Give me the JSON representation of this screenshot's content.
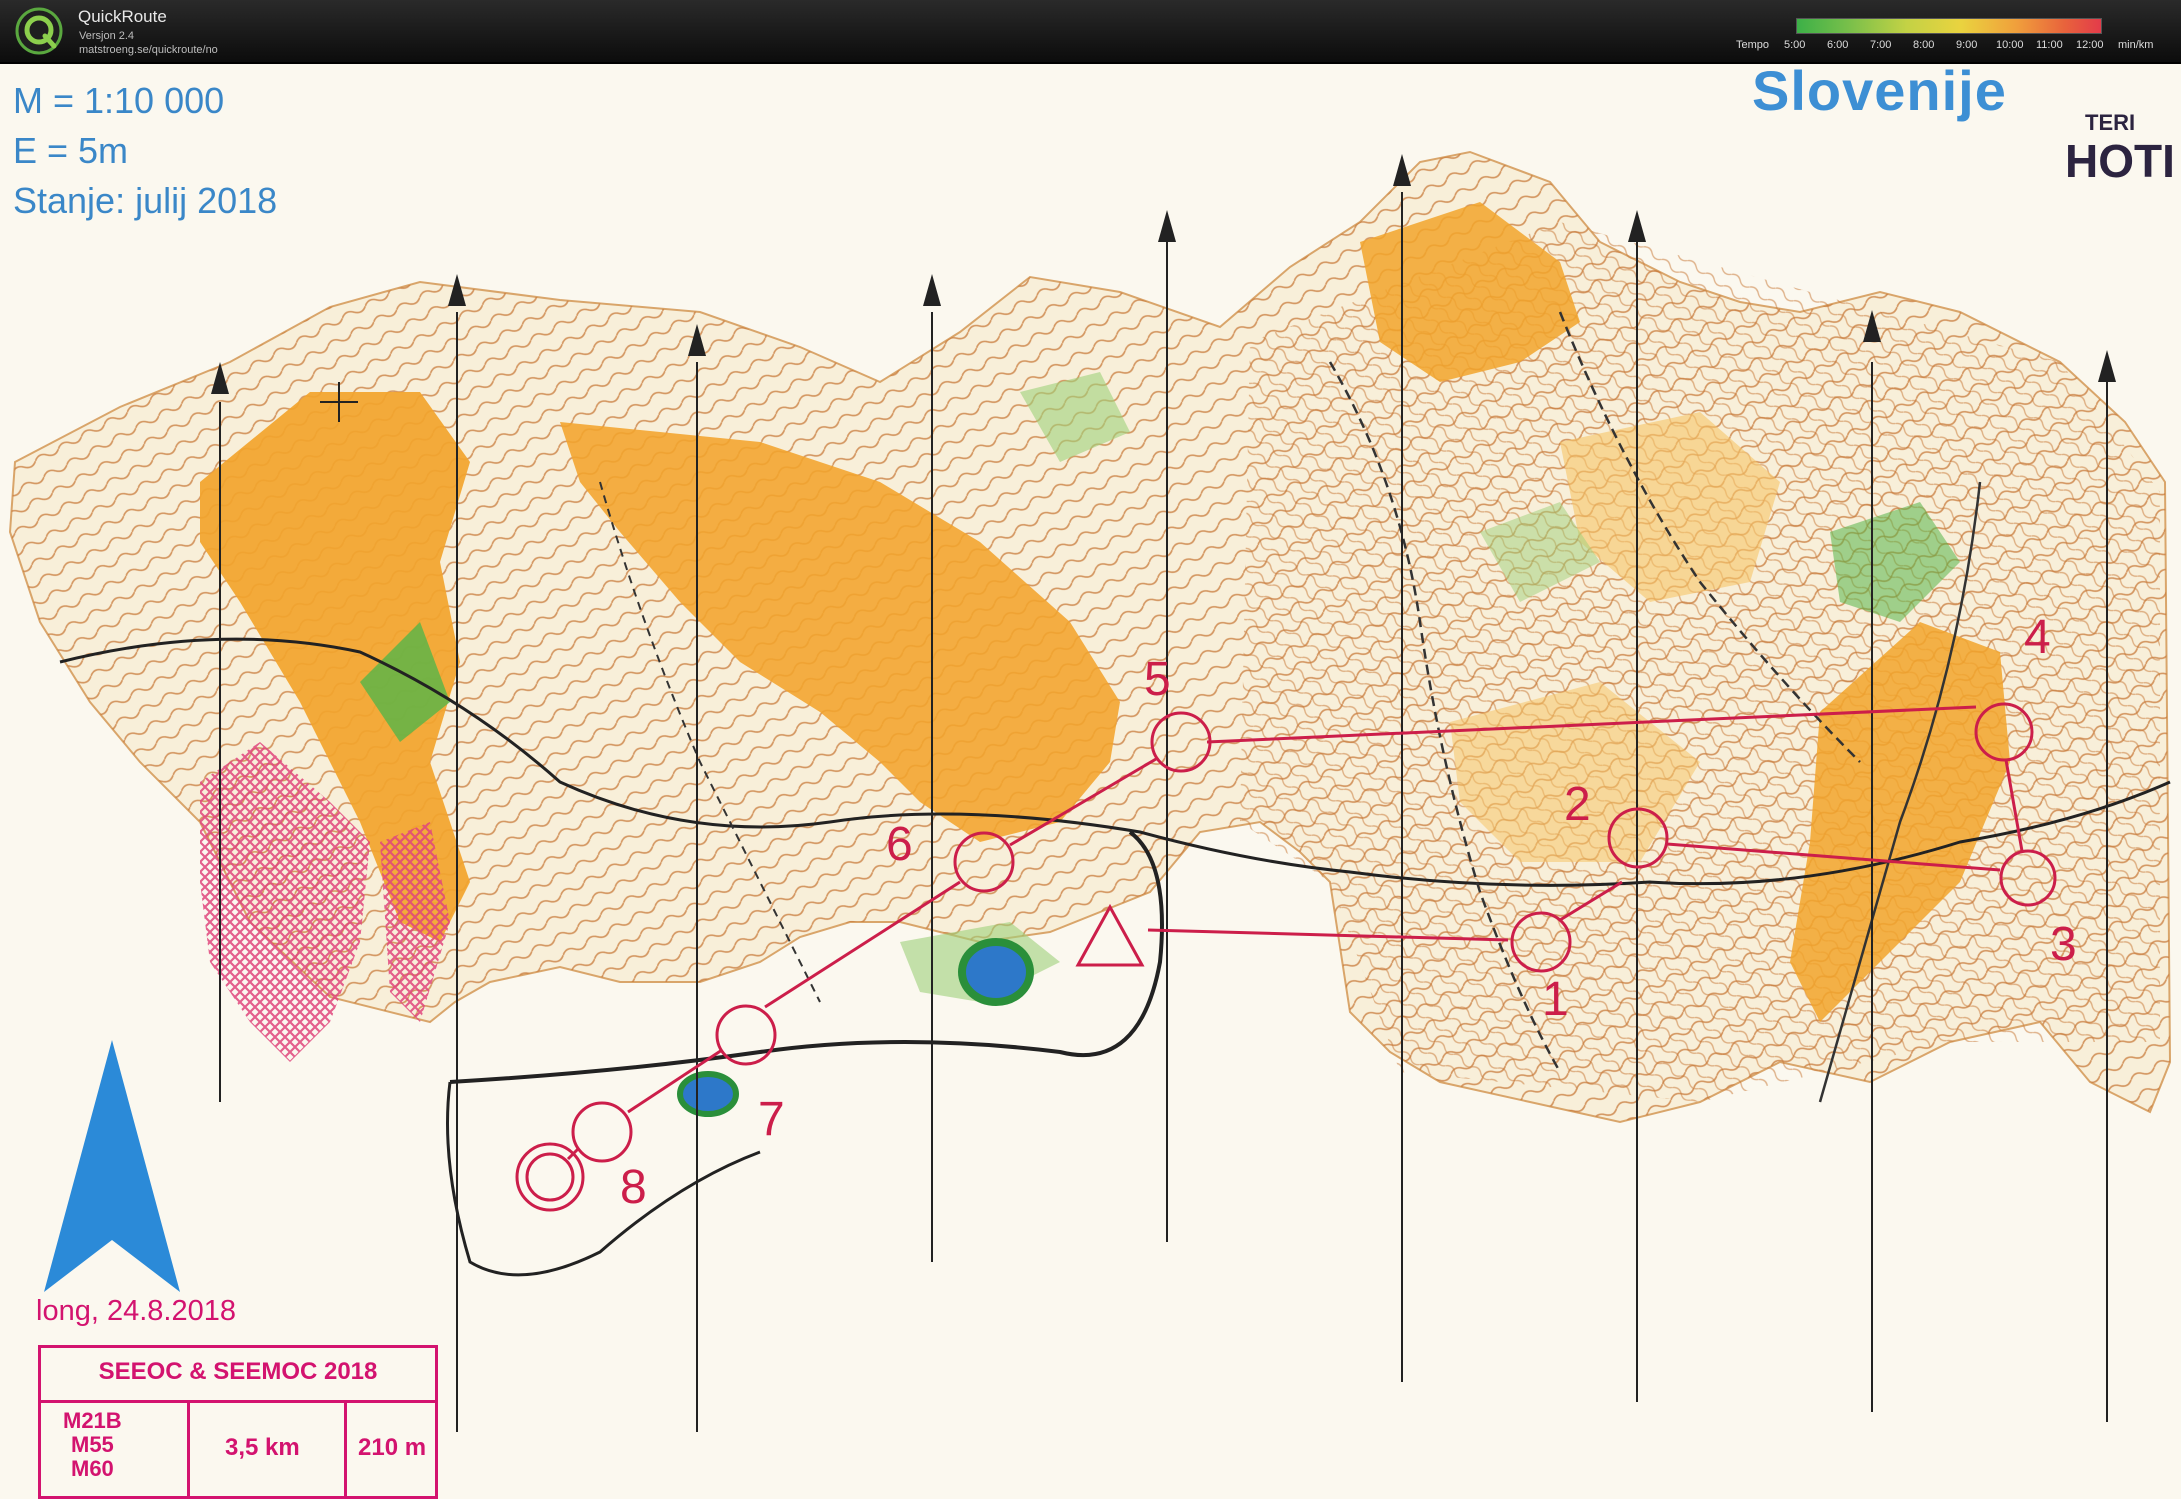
{
  "app": {
    "name": "QuickRoute",
    "version": "Versjon 2.4",
    "url": "matstroeng.se/quickroute/no"
  },
  "tempo_scale": {
    "label": "Tempo",
    "ticks": [
      "5:00",
      "6:00",
      "7:00",
      "8:00",
      "9:00",
      "10:00",
      "11:00",
      "12:00"
    ],
    "unit": "min/km",
    "colors": [
      "#3cb048",
      "#c3d245",
      "#ead33f",
      "#f0a03c",
      "#e33b4a"
    ]
  },
  "map": {
    "scale_text": "M = 1:10 000",
    "equidistance_text": "E = 5m",
    "status_text": "Stanje: julij 2018",
    "date_text": "long, 24.8.2018",
    "event_title": "SEEOC & SEEMOC 2018",
    "classes": [
      "M21B",
      "M55",
      "M60"
    ],
    "course_length": "3,5 km",
    "course_climb": "210 m",
    "sponsor_word": "Slovenije",
    "hotel_sub": "TERI",
    "hotel_word": "HOTI",
    "colors": {
      "course": "#cc1e4a",
      "open_land": "#f2a42c",
      "contour": "#c87a3a",
      "water": "#2d78c9",
      "vegetation": "#55b548",
      "restricted": "#e0457c",
      "text_blue": "#3a87c8",
      "info_magenta": "#d3136f"
    },
    "control_numbers": [
      "1",
      "2",
      "3",
      "4",
      "5",
      "6",
      "7",
      "8"
    ]
  }
}
